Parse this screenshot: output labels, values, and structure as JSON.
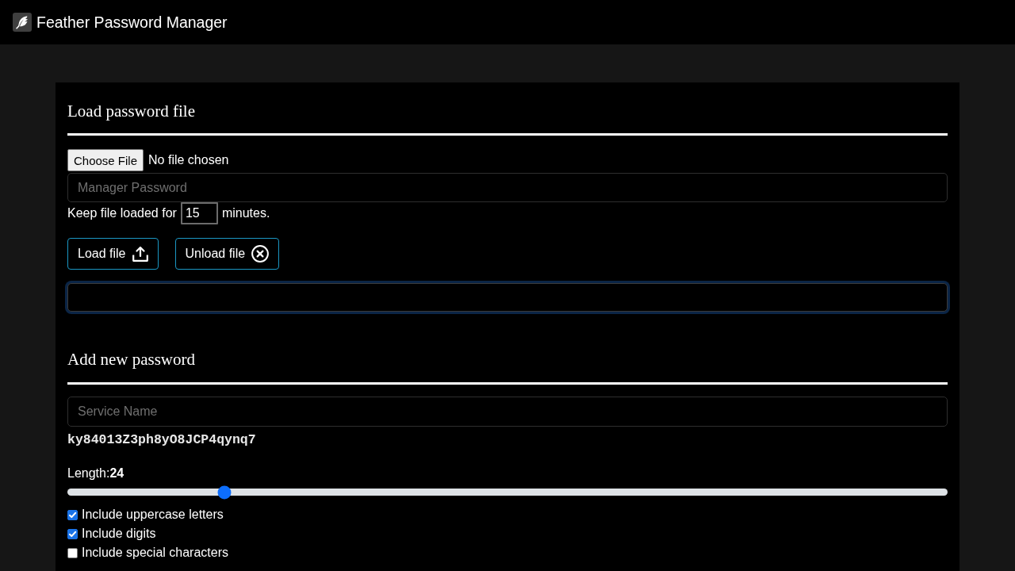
{
  "app": {
    "title": "Feather Password Manager"
  },
  "load_section": {
    "heading": "Load password file",
    "file_picker": {
      "button": "Choose File",
      "status": "No file chosen"
    },
    "password_field": {
      "placeholder": "Manager Password"
    },
    "keep_loaded": {
      "prefix": "Keep file loaded for",
      "value": "15",
      "suffix": "minutes."
    },
    "buttons": [
      {
        "label": "Load file",
        "kind": "upload"
      },
      {
        "label": "Unload file",
        "kind": "unload"
      }
    ],
    "output_field": {
      "focused": true
    }
  },
  "add_section": {
    "heading": "Add new password",
    "service_field": {
      "placeholder": "Service Name"
    },
    "generated_password": "ky84013Z3ph8yO8JCP4qynq7",
    "length": {
      "label": "Length:**24**",
      "level": 0.178
    },
    "options": [
      {
        "label": "Include uppercase letters",
        "checked": true
      },
      {
        "label": "Include digits",
        "checked": true
      },
      {
        "label": "Include special characters",
        "checked": false
      }
    ]
  }
}
